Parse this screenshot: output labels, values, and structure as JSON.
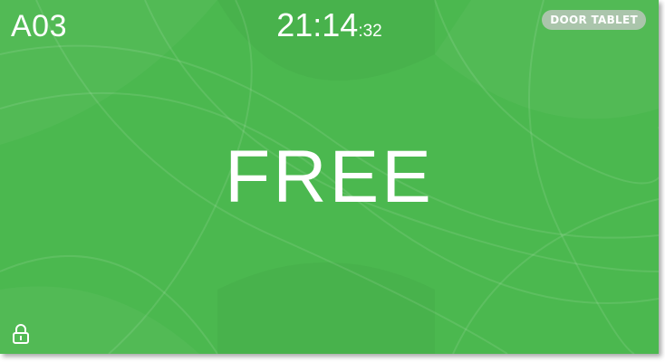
{
  "room": {
    "id": "A03"
  },
  "clock": {
    "hours_minutes": "21:14",
    "seconds": ":32"
  },
  "badge": {
    "label": "DOOR TABLET"
  },
  "status": {
    "label": "FREE",
    "color": "#4bb84f"
  },
  "icons": {
    "lock": "lock-icon"
  }
}
